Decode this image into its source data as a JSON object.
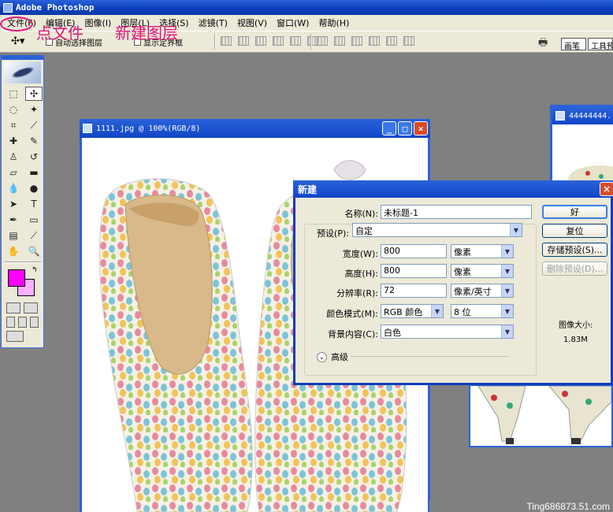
{
  "app": {
    "title": "Adobe Photoshop"
  },
  "menu": [
    "文件(F)",
    "编辑(E)",
    "图像(I)",
    "图层(L)",
    "选择(S)",
    "滤镜(T)",
    "视图(V)",
    "窗口(W)",
    "帮助(H)"
  ],
  "options": {
    "auto_select": "自动选择图层",
    "show_bounds": "显示定界框",
    "palette_brush": "画笔",
    "palette_tool": "工具预"
  },
  "annotations": {
    "step1": "点文件",
    "step2": "新建图层",
    "color": "#e0137a"
  },
  "colors": {
    "foreground": "#ff00ff",
    "background": "#ffb0ff"
  },
  "document": {
    "title": "1111.jpg @ 100%(RGB/8)"
  },
  "document2": {
    "title": "44444444."
  },
  "dialog": {
    "title": "新建",
    "name_label": "名称(N):",
    "name_value": "未标题-1",
    "preset_label": "预设(P):",
    "preset_value": "自定",
    "width_label": "宽度(W):",
    "width_value": "800",
    "width_unit": "像素",
    "height_label": "高度(H):",
    "height_value": "800",
    "height_unit": "像素",
    "resolution_label": "分辨率(R):",
    "resolution_value": "72",
    "resolution_unit": "像素/英寸",
    "color_mode_label": "颜色模式(M):",
    "color_mode_value": "RGB 颜色",
    "bit_depth": "8 位",
    "background_label": "背景内容(C):",
    "background_value": "白色",
    "advanced": "高级",
    "ok": "好",
    "reset": "复位",
    "save_preset": "存储预设(S)...",
    "delete_preset": "删除预设(D)...",
    "image_size_label": "图像大小:",
    "image_size_value": "1.83M"
  },
  "watermark": "Ting686873.51.com"
}
